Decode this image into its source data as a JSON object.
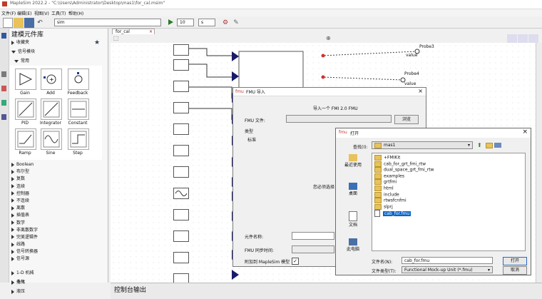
{
  "window": {
    "title": "MapleSim 2022.2 - \"C:\\Users\\Administrator\\Desktop\\mas1\\for_cal.msim\""
  },
  "menu": [
    "文件(F)",
    "编辑(E)",
    "视图(V)",
    "工具(T)",
    "帮助(H)"
  ],
  "toolbar": {
    "search_value": "sim",
    "time_value": "10",
    "time_unit": "s"
  },
  "library": {
    "title": "建模元件库",
    "favorites": "收藏夹",
    "signal_blocks": "信号模块",
    "common": "常用",
    "palette": [
      "Gain",
      "Add",
      "Feedback",
      "PID",
      "Integrator",
      "Constant",
      "Ramp",
      "Sine",
      "Step"
    ],
    "categories": [
      "Boolean",
      "布尔型",
      "复数",
      "连续",
      "控制器",
      "不连续",
      "离散",
      "插值表",
      "数学",
      "非离散数字",
      "完美逻辑件",
      "线路",
      "信号转换器",
      "信号源"
    ],
    "bottom": [
      "电气",
      "1-D 机械",
      "多体",
      "液压"
    ]
  },
  "tab": {
    "label": "for_cal"
  },
  "probes": [
    {
      "label": "Probe3",
      "value": "value"
    },
    {
      "label": "Probe4",
      "value": "value"
    }
  ],
  "console": {
    "title": "控制台输出"
  },
  "fmu_dialog": {
    "title": "FMU 导入",
    "subtitle": "导入一个 FMI 2.0 FMU",
    "fmu_file_label": "FMU 文件:",
    "browse_label": "浏览",
    "type_label": "类型",
    "type_value": "标准",
    "select_hint": "您必须选择",
    "component_name_label": "元件名称:",
    "sync_time_label": "FMU 同步时间:",
    "attach_label": "附加到 MapleSim 模型",
    "attach_checked": true
  },
  "open_dialog": {
    "title": "打开",
    "lookin_label": "查找(I):",
    "lookin_value": "mas1",
    "places": [
      "最近使用",
      "桌面",
      "文档",
      "此电脑"
    ],
    "files": [
      {
        "name": "+FMIKit",
        "type": "folder"
      },
      {
        "name": "cab_for_grt_fmi_rtw",
        "type": "folder"
      },
      {
        "name": "dual_space_grt_fmi_rtw",
        "type": "folder"
      },
      {
        "name": "examples",
        "type": "folder"
      },
      {
        "name": "grtfmi",
        "type": "folder"
      },
      {
        "name": "html",
        "type": "folder"
      },
      {
        "name": "include",
        "type": "folder"
      },
      {
        "name": "rtwsfcnfmi",
        "type": "folder"
      },
      {
        "name": "slprj",
        "type": "folder"
      },
      {
        "name": "cab_for.fmu",
        "type": "file",
        "selected": true
      }
    ],
    "filename_label": "文件名(N):",
    "filename_value": "cab_for.fmu",
    "filetype_label": "文件类型(T):",
    "filetype_value": "Functional Mock-up Unit (*.fmu)",
    "open_button": "打开",
    "cancel_button": "取消"
  }
}
